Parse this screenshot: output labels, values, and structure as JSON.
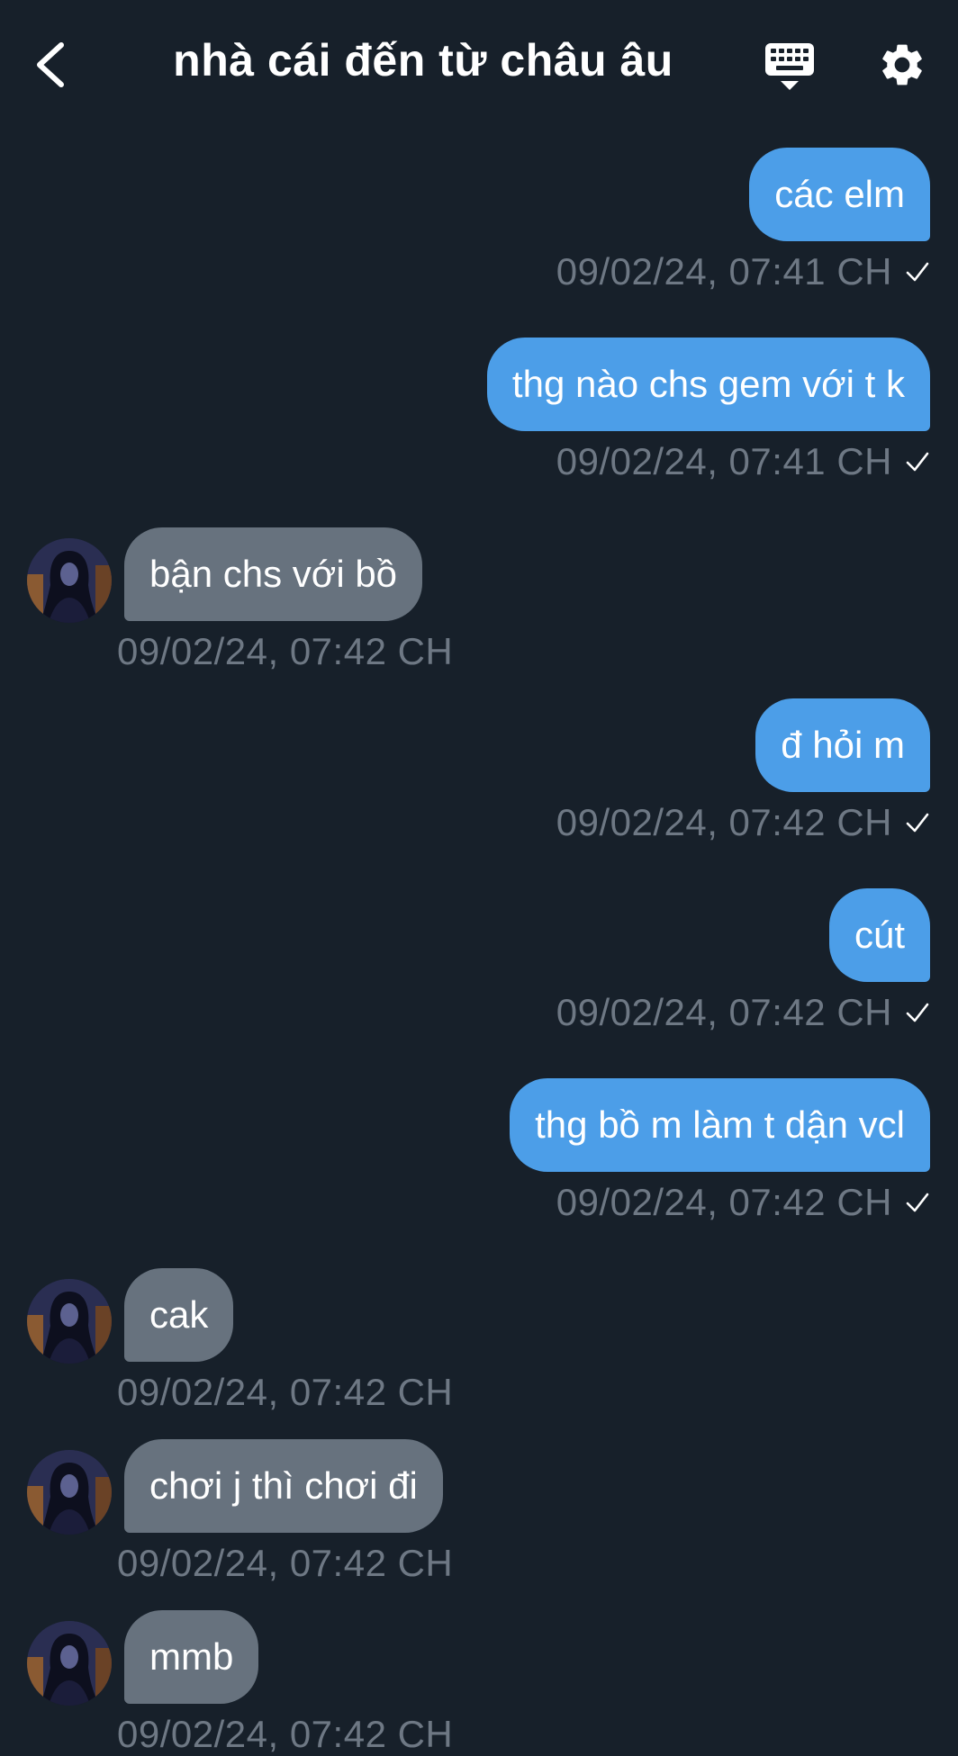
{
  "header": {
    "title": "nhà cái đến từ châu âu",
    "back_icon": "chevron-left-icon",
    "keyboard_icon": "keyboard-icon",
    "settings_icon": "gear-icon"
  },
  "colors": {
    "background": "#17202a",
    "outgoing_bubble": "#4c9ee8",
    "incoming_bubble": "#67727e",
    "timestamp": "#6e7884"
  },
  "messages": [
    {
      "direction": "out",
      "text": "các elm",
      "time": "09/02/24, 07:41 CH",
      "status_icon": "check-icon"
    },
    {
      "direction": "out",
      "text": "thg nào chs gem với t k",
      "time": "09/02/24, 07:41 CH",
      "status_icon": "check-icon"
    },
    {
      "direction": "in",
      "text": "bận chs với bồ",
      "time": "09/02/24, 07:42 CH"
    },
    {
      "direction": "out",
      "text": "đ hỏi m",
      "time": "09/02/24, 07:42 CH",
      "status_icon": "check-icon"
    },
    {
      "direction": "out",
      "text": "cút",
      "time": "09/02/24, 07:42 CH",
      "status_icon": "check-icon"
    },
    {
      "direction": "out",
      "text": "thg bồ m làm t dận vcl",
      "time": "09/02/24, 07:42 CH",
      "status_icon": "check-icon"
    },
    {
      "direction": "in",
      "text": "cak",
      "time": "09/02/24, 07:42 CH"
    },
    {
      "direction": "in",
      "text": "chơi j thì chơi đi",
      "time": "09/02/24, 07:42 CH"
    },
    {
      "direction": "in",
      "text": "mmb",
      "time": "09/02/24, 07:42 CH"
    }
  ]
}
